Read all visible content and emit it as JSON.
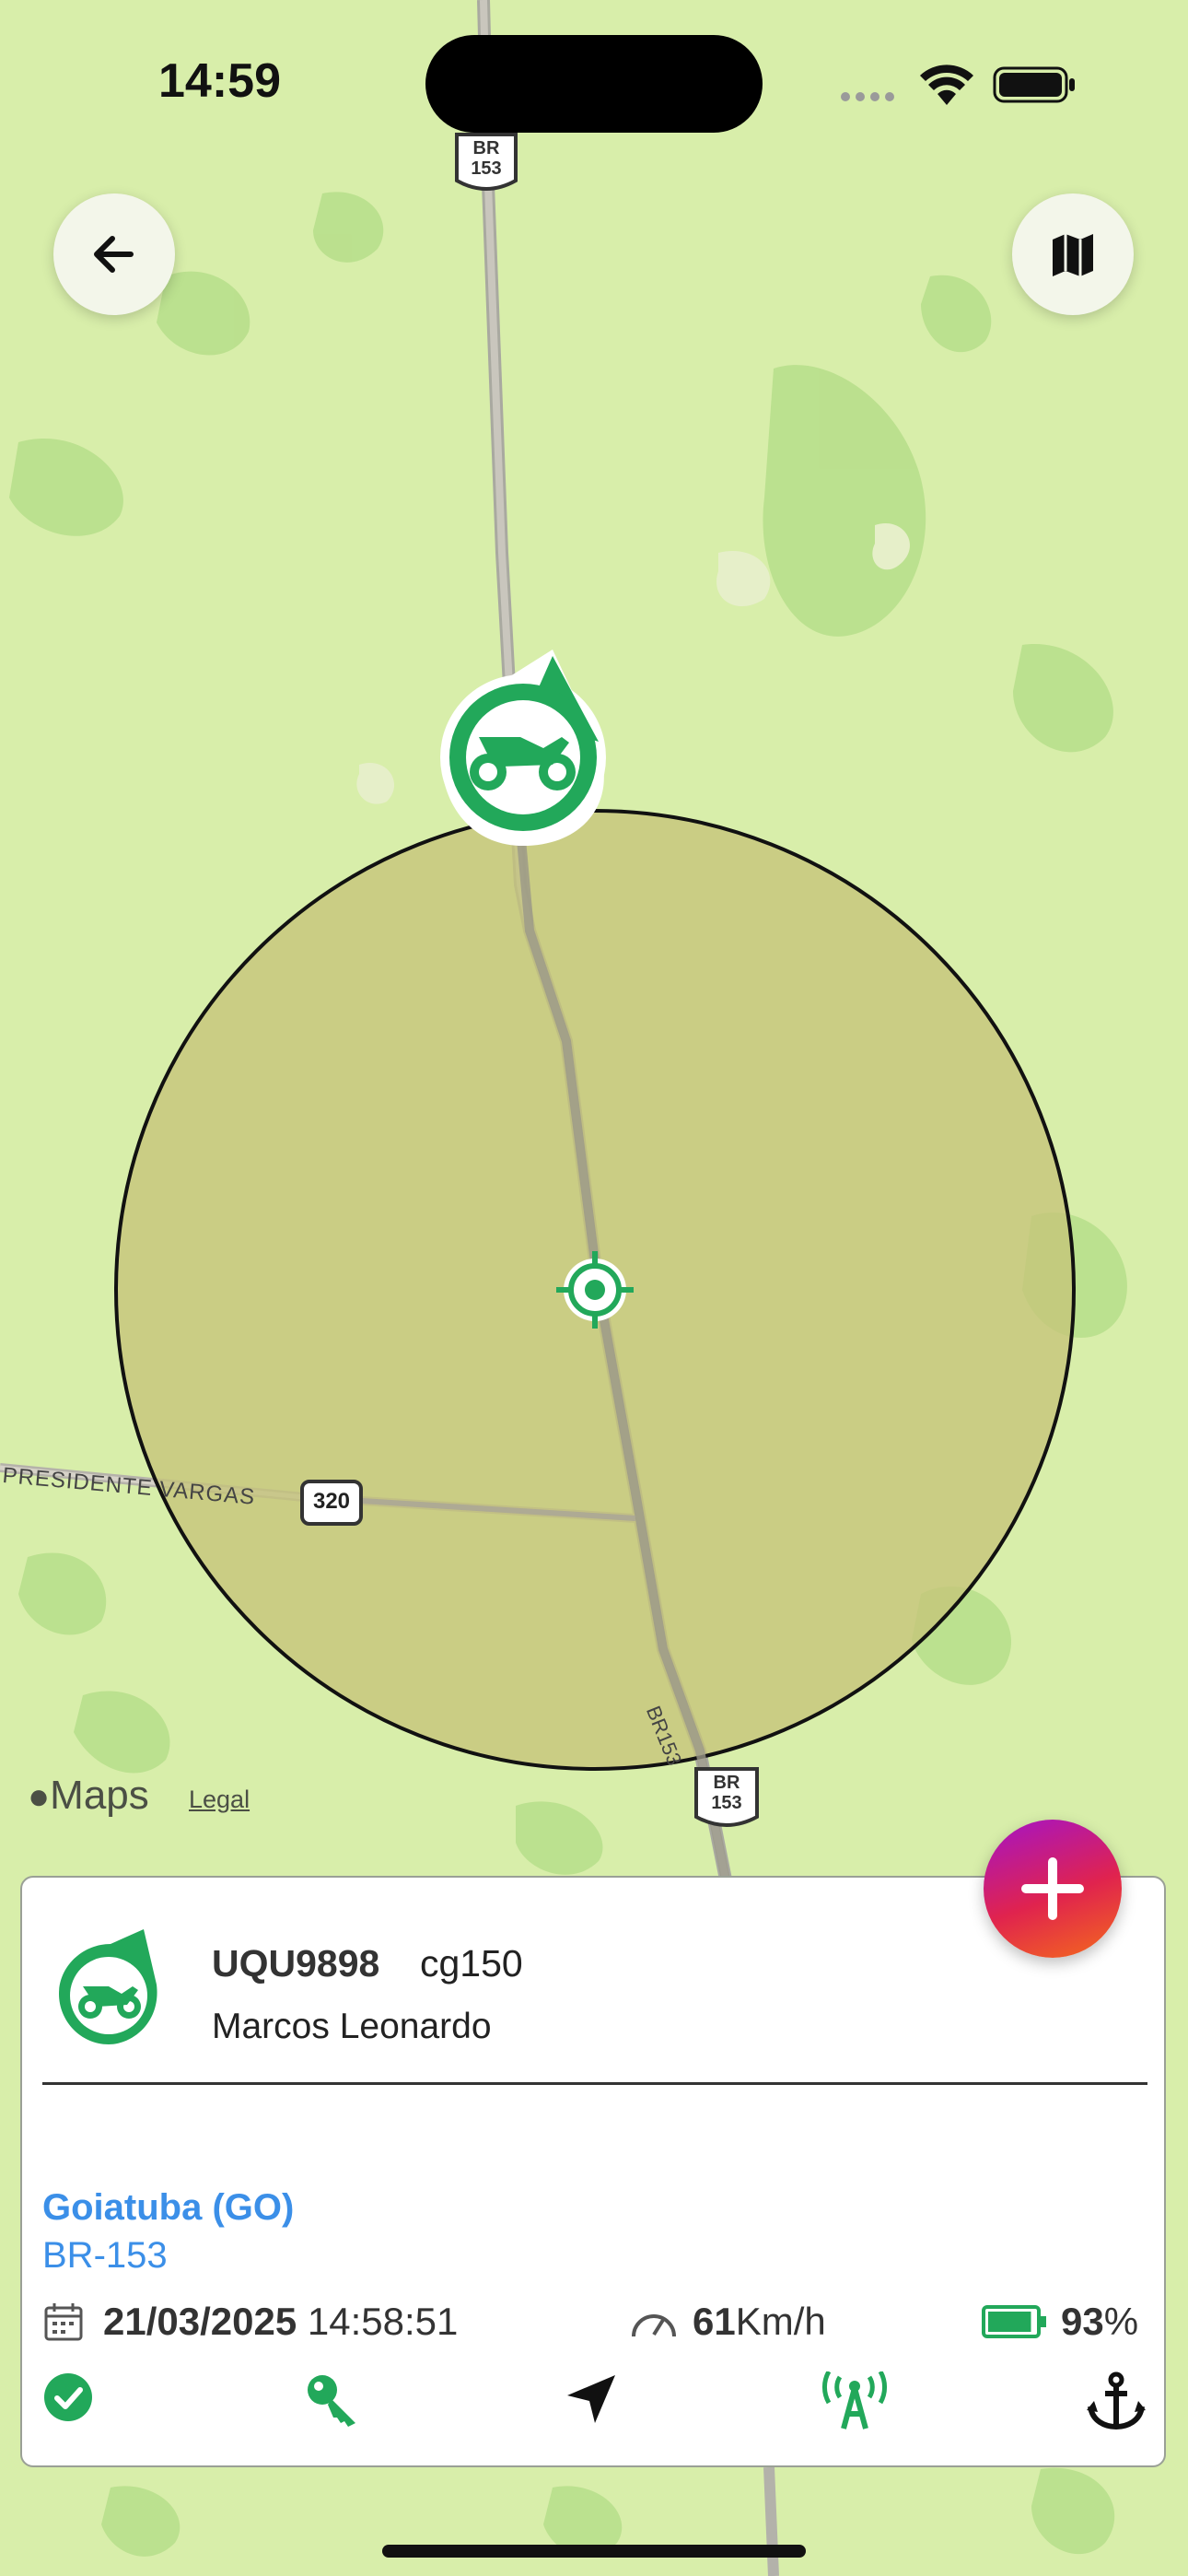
{
  "status_bar": {
    "time": "14:59"
  },
  "map": {
    "roads": [
      {
        "label": "BR-153 top shield",
        "line1": "BR",
        "line2": "153"
      },
      {
        "label": "BR-153 bottom shield",
        "line1": "BR",
        "line2": "153"
      }
    ],
    "shield_320": "320",
    "road_label_vargas": "PRESIDENTE VARGAS",
    "road_label_br153": "BR153",
    "maps_brand": "Maps",
    "legal": "Legal",
    "fence_color": "#c5c47a"
  },
  "header": {
    "back_icon": "arrow-left-icon",
    "map_type_icon": "map-icon"
  },
  "vehicle": {
    "plate": "UQU9898",
    "model": "cg150",
    "driver": "Marcos Leonardo",
    "city": "Goiatuba (GO)",
    "road": "BR-153",
    "date": "21/03/2025",
    "time": "14:58:51",
    "speed": "61",
    "speed_unit": "Km/h",
    "battery": "93",
    "battery_unit": "%",
    "battery_level": 0.93
  },
  "actions": {
    "fab_icon": "plus-icon",
    "icons": [
      "check-circle-icon",
      "key-icon",
      "navigation-arrow-icon",
      "antenna-icon",
      "anchor-icon"
    ]
  },
  "colors": {
    "brand_green": "#22a85a",
    "link_blue": "#3b8fe8"
  }
}
